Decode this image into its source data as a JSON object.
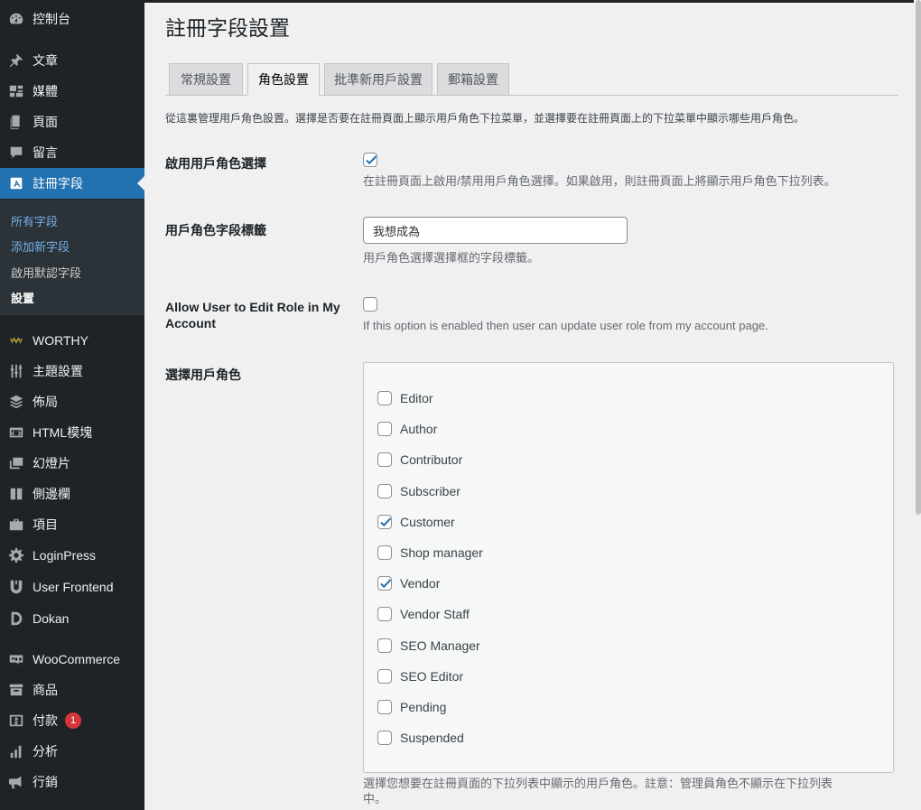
{
  "sidebar": {
    "items": [
      {
        "label": "控制台",
        "icon": "dashboard-icon"
      },
      {
        "label": "文章",
        "icon": "pin-icon"
      },
      {
        "label": "媒體",
        "icon": "media-icon"
      },
      {
        "label": "頁面",
        "icon": "page-icon"
      },
      {
        "label": "留言",
        "icon": "comment-icon"
      },
      {
        "label": "註冊字段",
        "icon": "registration-icon"
      },
      {
        "label": "WORTHY",
        "icon": "worthy-icon"
      },
      {
        "label": "主題設置",
        "icon": "sliders-icon"
      },
      {
        "label": "佈局",
        "icon": "layers-icon"
      },
      {
        "label": "HTML模塊",
        "icon": "code-icon"
      },
      {
        "label": "幻燈片",
        "icon": "slides-icon"
      },
      {
        "label": "側邊欄",
        "icon": "sidebar-icon"
      },
      {
        "label": "項目",
        "icon": "briefcase-icon"
      },
      {
        "label": "LoginPress",
        "icon": "gear-icon"
      },
      {
        "label": "User Frontend",
        "icon": "user-frontend-icon"
      },
      {
        "label": "Dokan",
        "icon": "dokan-icon"
      },
      {
        "label": "WooCommerce",
        "icon": "woo-icon"
      },
      {
        "label": "商品",
        "icon": "archive-icon"
      },
      {
        "label": "付款",
        "icon": "payment-icon"
      },
      {
        "label": "分析",
        "icon": "chart-icon"
      },
      {
        "label": "行銷",
        "icon": "megaphone-icon"
      }
    ],
    "payments_badge": "1",
    "submenu": [
      "所有字段",
      "添加新字段",
      "啟用默認字段",
      "設置"
    ]
  },
  "page": {
    "title": "註冊字段設置",
    "tabs": [
      "常規設置",
      "角色設置",
      "批準新用戶設置",
      "郵箱設置"
    ],
    "intro": "從這裏管理用戶角色設置。選擇是否要在註冊頁面上顯示用戶角色下拉菜單，並選擇要在註冊頁面上的下拉菜單中顯示哪些用戶角色。"
  },
  "settings": {
    "enable_role": {
      "label": "啟用用戶角色選擇",
      "checked": true,
      "desc": "在註冊頁面上啟用/禁用用戶角色選擇。如果啟用，則註冊頁面上將顯示用戶角色下拉列表。"
    },
    "role_field_label": {
      "label": "用戶角色字段標籤",
      "value": "我想成為",
      "desc": "用戶角色選擇選擇框的字段標籤。"
    },
    "allow_edit": {
      "label_line1": "Allow User to Edit Role in My",
      "label_line2": "Account",
      "checked": false,
      "desc": "If this option is enabled then user can update user role from my account page."
    },
    "select_roles": {
      "label": "選擇用戶角色",
      "roles": [
        {
          "name": "Editor",
          "checked": false
        },
        {
          "name": "Author",
          "checked": false
        },
        {
          "name": "Contributor",
          "checked": false
        },
        {
          "name": "Subscriber",
          "checked": false
        },
        {
          "name": "Customer",
          "checked": true
        },
        {
          "name": "Shop manager",
          "checked": false
        },
        {
          "name": "Vendor",
          "checked": true
        },
        {
          "name": "Vendor Staff",
          "checked": false
        },
        {
          "name": "SEO Manager",
          "checked": false
        },
        {
          "name": "SEO Editor",
          "checked": false
        },
        {
          "name": "Pending",
          "checked": false
        },
        {
          "name": "Suspended",
          "checked": false
        }
      ],
      "desc_line1": "選擇您想要在註冊頁面的下拉列表中顯示的用戶角色。註意：管理員角色不顯示在下拉列表",
      "desc_line2": "中。"
    }
  },
  "colors": {
    "sidebar_bg": "#1d2327",
    "accent": "#2271b1",
    "checkmark": "#2271b1",
    "badge": "#d63638"
  }
}
